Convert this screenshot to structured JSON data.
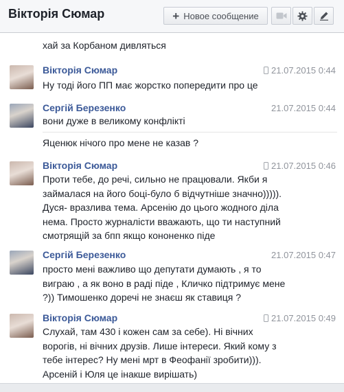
{
  "header": {
    "title": "Вікторія Сюмар",
    "new_message_label": "Новое сообщение",
    "icons": {
      "new": "plus-icon",
      "video": "video-camera-icon",
      "settings": "gear-icon",
      "edit": "compose-icon"
    }
  },
  "messages": [
    {
      "lines": [
        "хай за Корбаном дивляться"
      ]
    },
    {
      "sender": "Вікторія Сюмар",
      "time": "21.07.2015 0:44",
      "mobile": true,
      "lines": [
        "Ну тоді його ПП має жорстко попередити про це"
      ]
    },
    {
      "sender": "Сергій Березенко",
      "time": "21.07.2015 0:44",
      "mobile": false,
      "lines": [
        "вони дуже в великому конфлікті"
      ],
      "extra": "Яценюк нічого про мене не казав ?"
    },
    {
      "sender": "Вікторія Сюмар",
      "time": "21.07.2015 0:46",
      "mobile": true,
      "lines": [
        "Проти тебе, до речі, сильно не працювали. Якби я",
        "займалася на його боці-було б відчутніше значно))))).",
        "Дуся- вразлива тема. Арсенію до цього жодного діла",
        "нема. Просто журналісти вважають, що ти наступний",
        "смотрящій за бпп якщо кононенко піде"
      ]
    },
    {
      "sender": "Сергій Березенко",
      "time": "21.07.2015 0:47",
      "mobile": false,
      "lines": [
        "просто мені важливо що депутати думають , я то",
        "виграю , а як воно в раді піде , Кличко підтримує мене",
        "?)) Тимошенко доречі не знаєш як ставиця ?"
      ]
    },
    {
      "sender": "Вікторія Сюмар",
      "time": "21.07.2015 0:49",
      "mobile": true,
      "lines": [
        "Слухай, там 430 і кожен сам за себе). Ні вічних",
        "ворогів, ні вічних друзів. Лише інтереси. Який кому з",
        "тебе інтерес? Ну мені мрт в Феофанії зробити))).",
        "Арсеній і Юля це інакше вирішать)"
      ]
    }
  ],
  "colors": {
    "sender": "#3b5998",
    "text": "#1d2129",
    "time": "#90949c",
    "header_bg": "#f6f7f9"
  }
}
